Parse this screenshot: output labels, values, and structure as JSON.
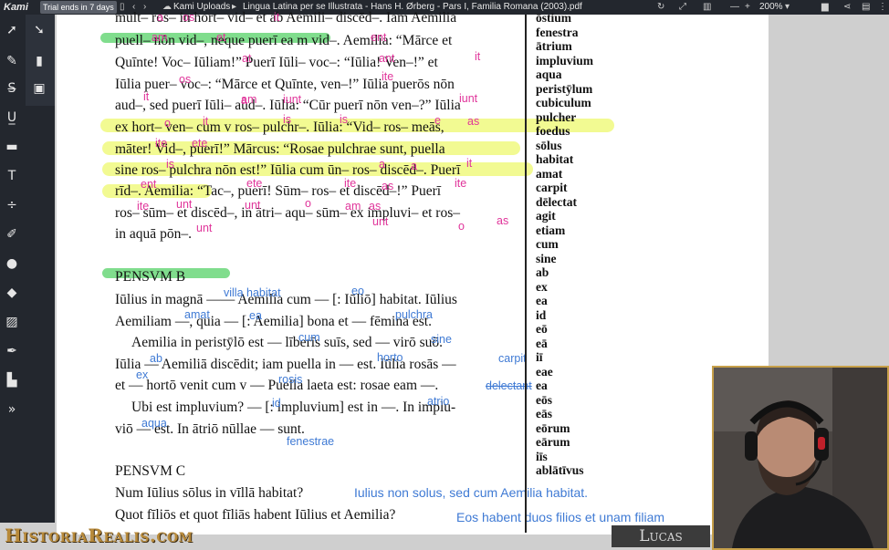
{
  "app": {
    "brand": "Kami",
    "trial": "Trial ends in 7 days",
    "breadcrumb_root": "Kami Uploads",
    "doc_title": "Lingua Latina per se Illustrata - Hans H. Ørberg - Pars I, Familia Romana (2003).pdf",
    "zoom": "200%"
  },
  "toolbar_left": [
    "select-tool",
    "select-arrow-tool",
    "markup-tool",
    "dictionary-tool",
    "strikethrough-tool",
    "ocr-tool",
    "underline-tool",
    "comment-tool",
    "text-tool",
    "equation-tool",
    "drawing-tool",
    "shapes-tool",
    "eraser-tool",
    "image-tool",
    "signature-tool",
    "custom-tool",
    "expand-more"
  ],
  "text_lines": [
    "mult‒ ros‒ in hort‒ vid‒ et ab Aemili‒ discēd‒. Iam Aemilia",
    "puell‒ nōn vid‒, neque puerī ea m vid‒. Aemilia: “Mārce et",
    "Quīnte! Voc‒ Iūliam!” Puerī Iūli‒ voc‒: “Iūlia! Ven‒!” et",
    "Iūlia puer‒ voc‒: “Mārce et Quīnte, ven‒!” Iūlia puerōs nōn",
    "aud‒, sed puerī Iūli‒ aud‒. Iūlia: “Cūr puerī nōn ven‒?” Iūlia",
    "ex hort‒ ven‒ cum v ros‒ pulchr‒. Iūlia: “Vid‒ ros‒ meās,",
    "māter! Vid‒, puerī!” Mārcus: “Rosae pulchrae sunt, puella",
    "sine ros‒ pulchra nōn est!” Iūlia cum ūn‒ ros‒ discēd‒. Puerī",
    "rīd‒. Aemilia: “Tac‒, puerī! Sūm‒ ros‒ et discēd‒!” Puerī",
    "ros‒ sūm‒ et discēd‒, in ātri‒ aqu‒ sūm‒ ex impluvi‒ et ros‒",
    "in aquā pōn‒.",
    "PENSVM B",
    "Iūlius in magnā —— Aemilia cum — [: Iūliō] habitat. Iūlius",
    "Aemiliam —, quia — [: Aemilia] bona et — fēmina est.",
    "Aemilia in peristӯlō est — līberīs suīs, sed — virō suō.",
    "Iūlia — Aemiliā discēdit; iam puella in — est. Iūlia rosās —",
    "et — hortō venit cum v — Puella laeta est: rosae eam —.",
    "Ubi est impluvium? — [: impluvium] est in —. In implu-",
    "viō — est. In ātriō nūllae — sunt.",
    "PENSVM C",
    "Num Iūlius sōlus in vīllā habitat?",
    "Quot fīliōs et quot fīliās habent Iūlius et Aemilia?"
  ],
  "pink_notes": [
    "a",
    "os",
    "it",
    "am",
    "et",
    "ent",
    "at",
    "ant",
    "it",
    "os",
    "ite",
    "am",
    "iunt",
    "iunt",
    "it",
    "a",
    "o",
    "it",
    "is",
    "is",
    "e",
    "as",
    "ite",
    "ete",
    "is",
    "a",
    "a",
    "it",
    "ent",
    "ete",
    "ite",
    "as",
    "ite",
    "ite",
    "as",
    "unt",
    "o",
    "am",
    "unt",
    "as",
    "unt",
    "o",
    "unt"
  ],
  "blue_notes": [
    "villa habitat",
    "eo",
    "amat",
    "ea",
    "pulchra",
    "cum",
    "sine",
    "ab",
    "horto",
    "carpit",
    "ex",
    "rosis",
    "delectant",
    "id",
    "atrio",
    "aqua",
    "fenestrae",
    "Iulius non solus, sed cum Aemilia habitat.",
    "Eos habent duos filios et unam filiam"
  ],
  "vocab": [
    "ōstium",
    "fenestra",
    "ātrium",
    "impluvium",
    "aqua",
    "peristӯlum",
    "cubiculum",
    "pulcher",
    "foedus",
    "sōlus",
    "habitat",
    "amat",
    "carpit",
    "dēlectat",
    "agit",
    "etiam",
    "cum",
    "sine",
    "ab",
    "ex",
    "ea",
    "id",
    "eō",
    "eā",
    "iī",
    "eae",
    "ea",
    "eōs",
    "eās",
    "eōrum",
    "eārum",
    "iīs",
    "ablātīvus"
  ],
  "watermark": {
    "site": "HistoriaRealis.com",
    "name": "Lucas"
  }
}
